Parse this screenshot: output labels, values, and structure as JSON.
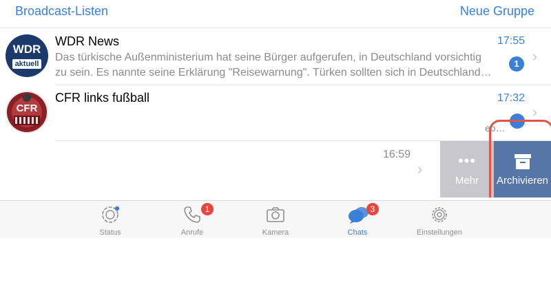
{
  "top": {
    "left_link": "Broadcast-Listen",
    "right_link": "Neue Gruppe"
  },
  "chats": [
    {
      "name": "WDR News",
      "time": "17:55",
      "preview_line1": "Das türkische Außenministerium hat seine Bürger aufgerufen, in Deutschland vorsichtig",
      "preview_line2": "zu sein. Es nannte seine Erklärung \"Reisewarnung\". Türken sollten sich in Deutschland…",
      "unread": "1",
      "avatar_text_top": "WDR",
      "avatar_text_bottom": "aktuell"
    },
    {
      "name": "CFR links fußball",
      "time": "17:32",
      "preview_fragment": "eo…",
      "avatar_text": "CFR"
    },
    {
      "time": "16:59"
    }
  ],
  "swipe_actions": {
    "more_label": "Mehr",
    "archive_label": "Archivieren"
  },
  "tabbar": [
    {
      "label": "Status",
      "icon": "status-icon"
    },
    {
      "label": "Anrufe",
      "icon": "phone-icon",
      "badge": "1"
    },
    {
      "label": "Kamera",
      "icon": "camera-icon"
    },
    {
      "label": "Chats",
      "icon": "chats-icon",
      "badge": "3",
      "active": true
    },
    {
      "label": "Einstellungen",
      "icon": "gear-icon"
    }
  ],
  "colors": {
    "accent": "#3a80d9",
    "badge_red": "#e6463b",
    "archive_bg": "#5676a8",
    "more_bg": "#c8c8cc",
    "highlight_outline": "#e0544a"
  }
}
